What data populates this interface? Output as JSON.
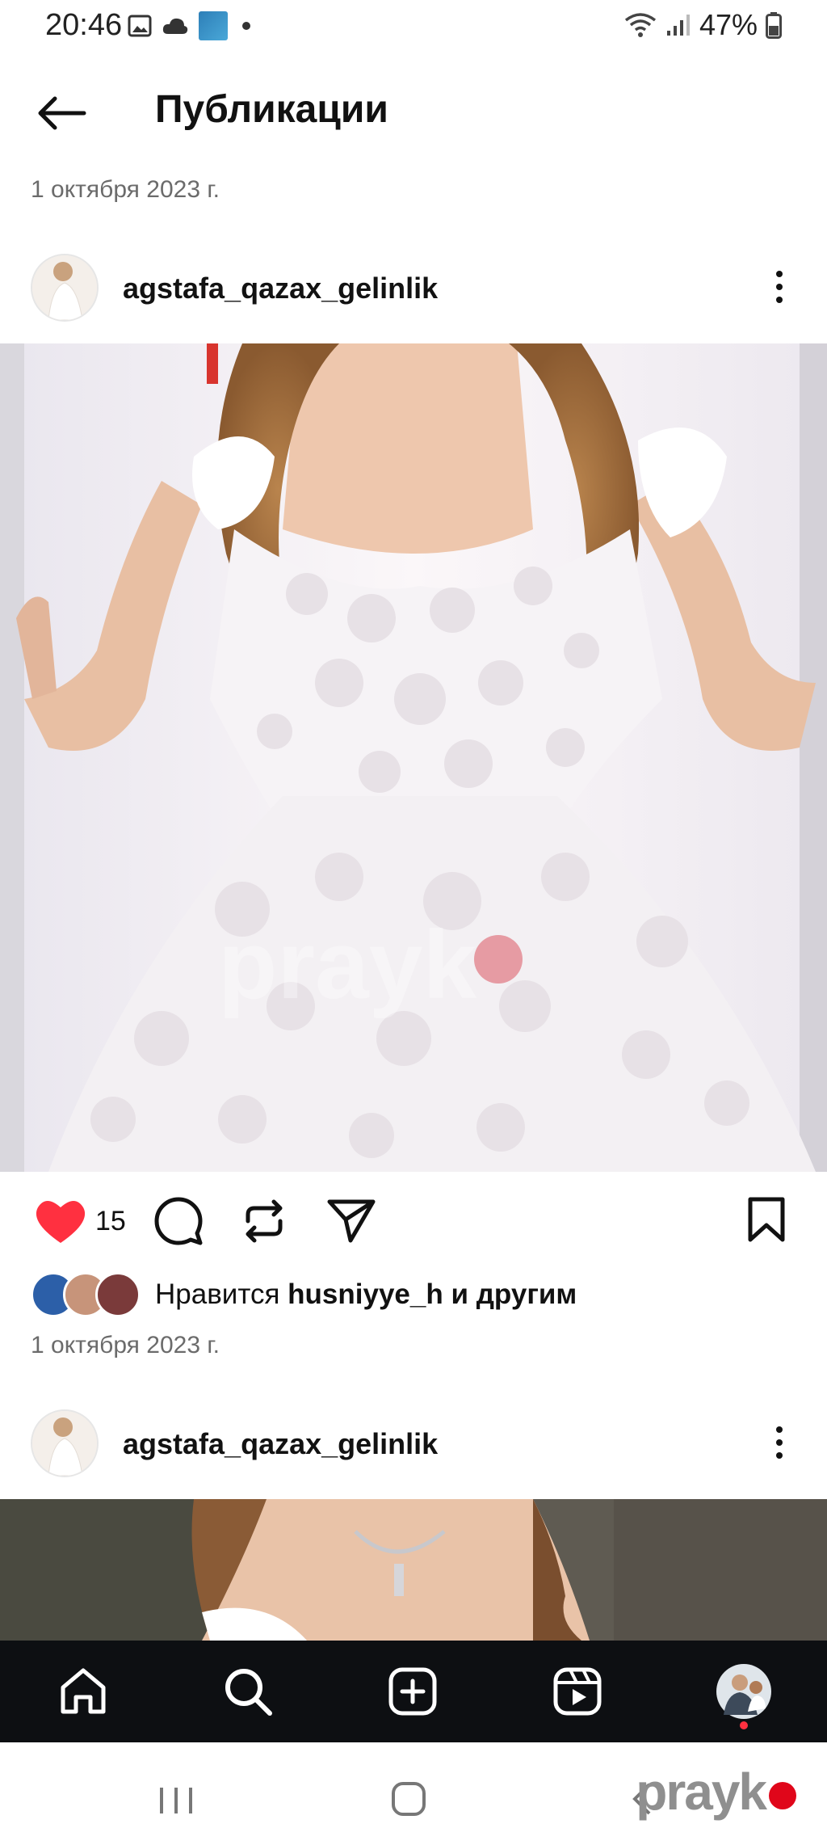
{
  "status_bar": {
    "time": "20:46",
    "battery": "47%"
  },
  "header": {
    "title": "Публикации"
  },
  "posts": [
    {
      "date_top": "1 октября 2023 г.",
      "username": "agstafa_qazax_gelinlik",
      "like_count": "15",
      "liked": true,
      "likes_prefix": "Нравится ",
      "likes_user": "husniyye_h",
      "likes_suffix": " и другим",
      "date": "1 октября 2023 г.",
      "image_watermark": "prayk"
    },
    {
      "username": "agstafa_qazax_gelinlik"
    }
  ],
  "bottom_nav": [
    "home",
    "search",
    "create",
    "reels",
    "profile"
  ],
  "system_nav": {
    "watermark": "prayk"
  },
  "colors": {
    "like_red": "#ff3040",
    "nav_bg": "#0d0f12"
  }
}
